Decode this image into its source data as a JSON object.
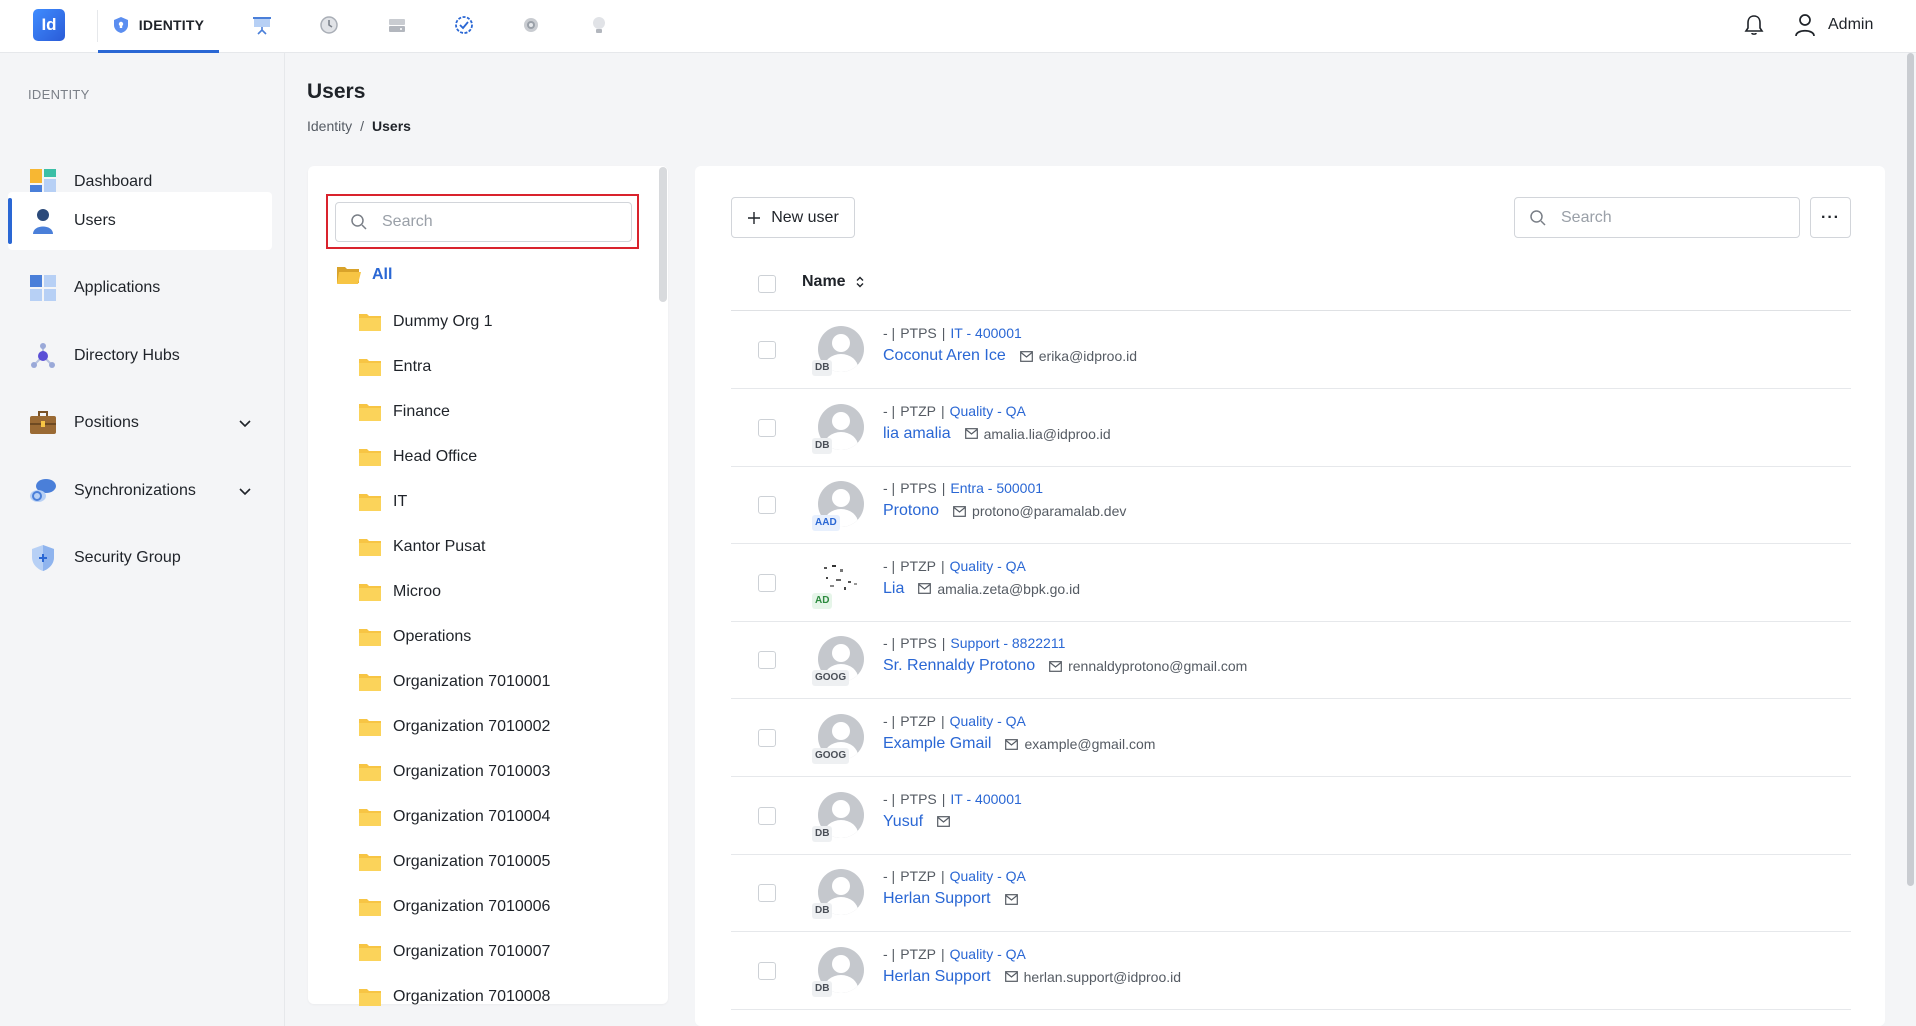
{
  "app": {
    "logo": "Id",
    "module": "IDENTITY",
    "user": "Admin"
  },
  "sidebar": {
    "section": "IDENTITY",
    "items": [
      {
        "label": "Dashboard"
      },
      {
        "label": "Users"
      },
      {
        "label": "Applications"
      },
      {
        "label": "Directory Hubs"
      },
      {
        "label": "Positions"
      },
      {
        "label": "Synchronizations"
      },
      {
        "label": "Security Group"
      }
    ]
  },
  "header": {
    "title": "Users",
    "breadcrumb": {
      "parent": "Identity",
      "sep": "/",
      "current": "Users"
    }
  },
  "tree": {
    "search_placeholder": "Search",
    "all_label": "All",
    "items": [
      "Dummy Org 1",
      "Entra",
      "Finance",
      "Head Office",
      "IT",
      "Kantor Pusat",
      "Microo",
      "Operations",
      "Organization 7010001",
      "Organization 7010002",
      "Organization 7010003",
      "Organization 7010004",
      "Organization 7010005",
      "Organization 7010006",
      "Organization 7010007",
      "Organization 7010008"
    ]
  },
  "users": {
    "new_user_label": "New user",
    "search_placeholder": "Search",
    "more_label": "···",
    "column_name": "Name",
    "rows": [
      {
        "prefix": "- |",
        "company": "PTPS",
        "sep": "|",
        "dept": "IT - 400001",
        "name": "Coconut Aren Ice",
        "email": "erika@idproo.id",
        "source": "DB"
      },
      {
        "prefix": "- |",
        "company": "PTZP",
        "sep": "|",
        "dept": "Quality - QA",
        "name": "lia amalia",
        "email": "amalia.lia@idproo.id",
        "source": "DB"
      },
      {
        "prefix": "- |",
        "company": "PTPS",
        "sep": "|",
        "dept": "Entra - 500001",
        "name": "Protono",
        "email": "protono@paramalab.dev",
        "source": "AAD"
      },
      {
        "prefix": "- |",
        "company": "PTZP",
        "sep": "|",
        "dept": "Quality - QA",
        "name": "Lia",
        "email": "amalia.zeta@bpk.go.id",
        "source": "AD"
      },
      {
        "prefix": "- |",
        "company": "PTPS",
        "sep": "|",
        "dept": "Support - 8822211",
        "name": "Sr. Rennaldy Protono",
        "email": "rennaldyprotono@gmail.com",
        "source": "GOOG"
      },
      {
        "prefix": "- |",
        "company": "PTZP",
        "sep": "|",
        "dept": "Quality - QA",
        "name": "Example Gmail",
        "email": "example@gmail.com",
        "source": "GOOG"
      },
      {
        "prefix": "- |",
        "company": "PTPS",
        "sep": "|",
        "dept": "IT - 400001",
        "name": "Yusuf",
        "email": "",
        "source": "DB"
      },
      {
        "prefix": "- |",
        "company": "PTZP",
        "sep": "|",
        "dept": "Quality - QA",
        "name": "Herlan Support",
        "email": "",
        "source": "DB"
      },
      {
        "prefix": "- |",
        "company": "PTZP",
        "sep": "|",
        "dept": "Quality - QA",
        "name": "Herlan Support",
        "email": "herlan.support@idproo.id",
        "source": "DB"
      }
    ]
  },
  "colors": {
    "accent": "#2a67d4",
    "highlight_border": "#d9232d",
    "folder": "#f7c544"
  }
}
